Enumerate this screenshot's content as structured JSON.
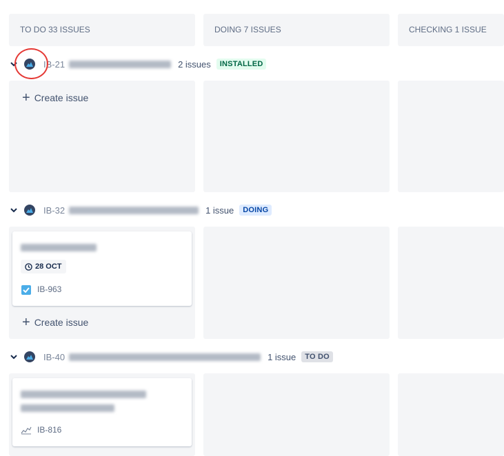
{
  "columns": [
    {
      "title": "TO DO 33 ISSUES"
    },
    {
      "title": "DOING 7 ISSUES"
    },
    {
      "title": "CHECKING 1 ISSUE"
    }
  ],
  "swimlanes": [
    {
      "key": "IB-21",
      "count": "2 issues",
      "status": "INSTALLED",
      "create_label": "Create issue"
    },
    {
      "key": "IB-32",
      "count": "1 issue",
      "status": "DOING",
      "card": {
        "due": "28 OCT",
        "key": "IB-963",
        "type": "task"
      },
      "create_label": "Create issue"
    },
    {
      "key": "IB-40",
      "count": "1 issue",
      "status": "TO DO",
      "card": {
        "key": "IB-816",
        "type": "improvement"
      }
    }
  ],
  "colors": {
    "installed_bg": "#e3fcef",
    "installed_fg": "#006644",
    "doing_bg": "#deebff",
    "doing_fg": "#0747a6",
    "todo_bg": "#dfe1e6",
    "todo_fg": "#42526e",
    "annotation": "#e53935"
  }
}
